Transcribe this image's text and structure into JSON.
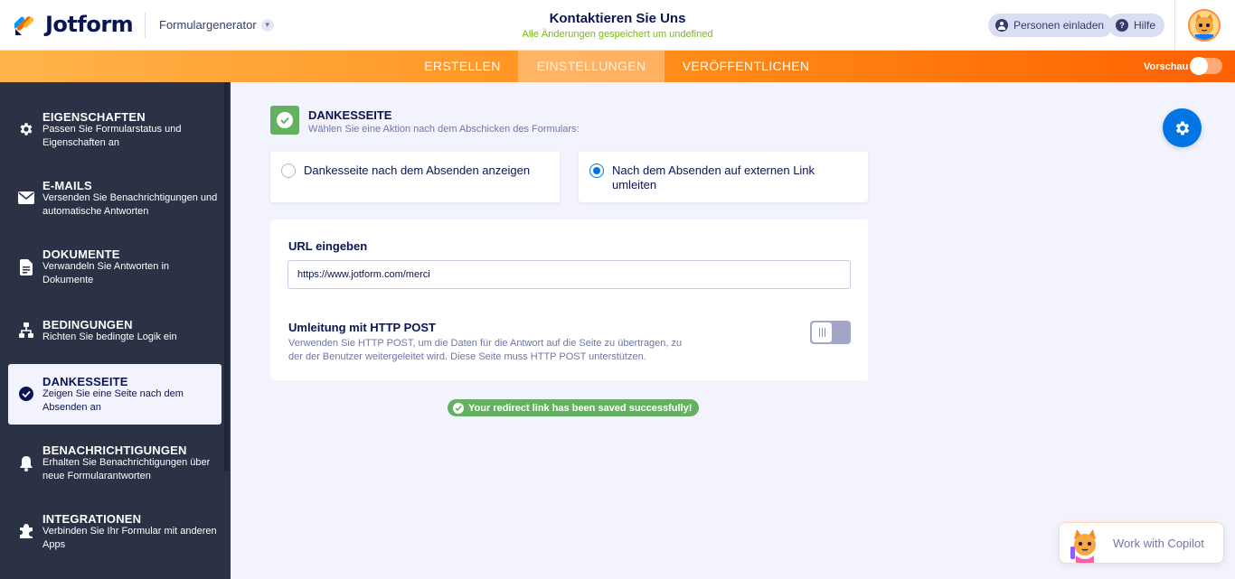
{
  "header": {
    "brand": "Jotform",
    "builder_label": "Formulargenerator",
    "form_title": "Kontaktieren Sie Uns",
    "save_status": "Alle Änderungen gespeichert um undefined",
    "invite_label": "Personen einladen",
    "help_label": "Hilfe"
  },
  "nav": {
    "tabs": [
      {
        "label": "ERSTELLEN",
        "active": false
      },
      {
        "label": "EINSTELLUNGEN",
        "active": true
      },
      {
        "label": "VERÖFFENTLICHEN",
        "active": false
      }
    ],
    "preview_label": "Vorschau",
    "preview_on": false
  },
  "sidebar": {
    "items": [
      {
        "title": "EIGENSCHAFTEN",
        "desc": "Passen Sie Formularstatus und Eigenschaften an",
        "icon": "gear-icon"
      },
      {
        "title": "E-MAILS",
        "desc": "Versenden Sie Benachrichtigungen und automatische Antworten",
        "icon": "envelope-icon"
      },
      {
        "title": "DOKUMENTE",
        "desc": "Verwandeln Sie Antworten in Dokumente",
        "icon": "document-icon"
      },
      {
        "title": "BEDINGUNGEN",
        "desc": "Richten Sie bedingte Logik ein",
        "icon": "sitemap-icon"
      },
      {
        "title": "DANKESSEITE",
        "desc": "Zeigen Sie eine Seite nach dem Absenden an",
        "icon": "check-circle-icon",
        "active": true
      },
      {
        "title": "BENACHRICHTIGUNGEN",
        "desc": "Erhalten Sie Benachrichtigungen über neue Formularantworten",
        "icon": "bell-icon"
      },
      {
        "title": "INTEGRATIONEN",
        "desc": "Verbinden Sie Ihr Formular mit anderen Apps",
        "icon": "puzzle-icon"
      }
    ]
  },
  "main": {
    "section_title": "DANKESSEITE",
    "section_sub": "Wählen Sie eine Aktion nach dem Abschicken des Formulars:",
    "options": [
      {
        "label": "Dankesseite nach dem Absenden anzeigen",
        "selected": false
      },
      {
        "label": "Nach dem Absenden auf externen Link umleiten",
        "selected": true
      }
    ],
    "url_label": "URL eingeben",
    "url_value": "https://www.jotform.com/merci",
    "post_title": "Umleitung mit HTTP POST",
    "post_desc": "Verwenden Sie HTTP POST, um die Daten für die Antwort auf die Seite zu übertragen, zu der der Benutzer weitergeleitet wird. Diese Seite muss HTTP POST unterstützen.",
    "post_enabled": false,
    "success_message": "Your redirect link has been saved successfully!"
  },
  "copilot": {
    "label": "Work with Copilot"
  },
  "colors": {
    "accent_blue": "#0075e3",
    "success_green": "#64b161",
    "sidebar_bg": "#2b3245",
    "nav_orange": "#ff6100"
  }
}
